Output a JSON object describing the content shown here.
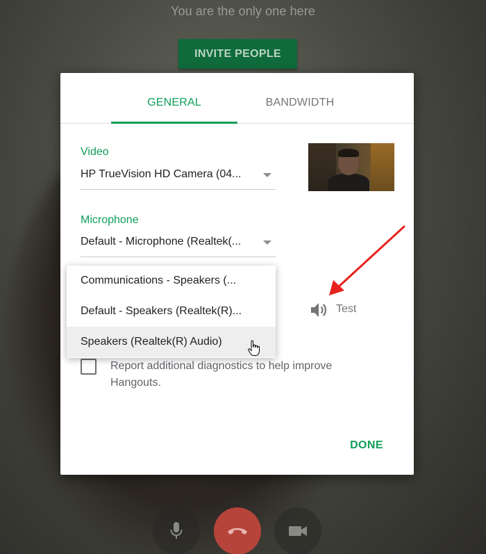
{
  "call": {
    "alone_text": "You are the only one here",
    "invite_label": "INVITE PEOPLE"
  },
  "settings": {
    "tabs": [
      {
        "label": "GENERAL",
        "active": true
      },
      {
        "label": "BANDWIDTH",
        "active": false
      }
    ],
    "video": {
      "label": "Video",
      "selected": "HP TrueVision HD Camera (04..."
    },
    "microphone": {
      "label": "Microphone",
      "selected": "Default - Microphone (Realtek(..."
    },
    "speakers": {
      "options": [
        "Communications - Speakers (...",
        "Default - Speakers (Realtek(R)...",
        "Speakers (Realtek(R) Audio)"
      ],
      "hovered_index": 2,
      "test_label": "Test"
    },
    "diagnostics": {
      "label": "Report additional diagnostics to help improve Hangouts.",
      "checked": false
    },
    "done_label": "DONE"
  },
  "controls": [
    {
      "icon": "microphone-icon"
    },
    {
      "icon": "hang-up-icon"
    },
    {
      "icon": "video-camera-icon"
    }
  ],
  "colors": {
    "accent": "#0f9d58",
    "invite_button": "#0f6b3b",
    "hangup": "#b6443a",
    "annotation_arrow": "#e8221c"
  }
}
